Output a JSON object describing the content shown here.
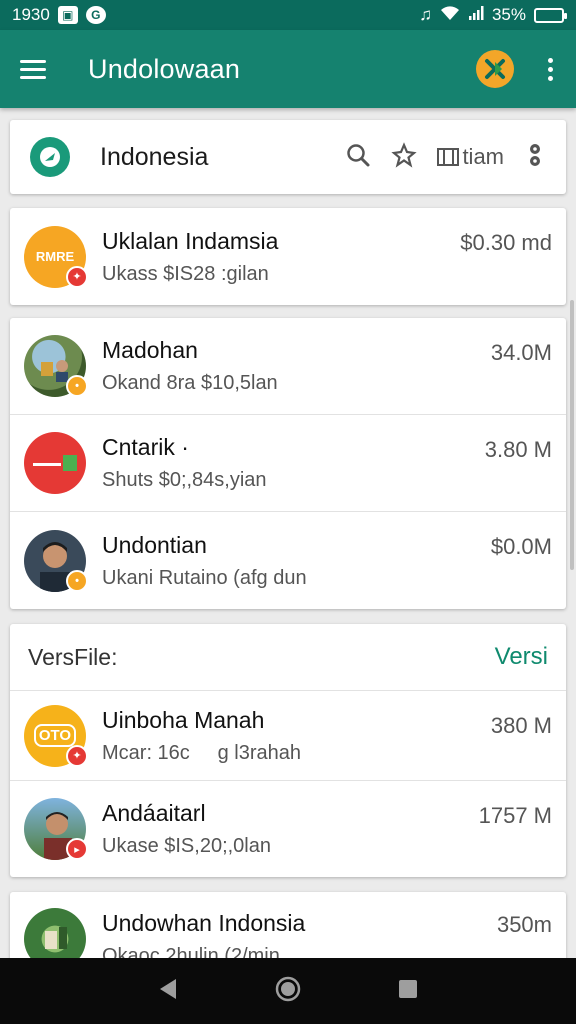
{
  "status_bar": {
    "time": "1930",
    "signal_label": "G",
    "battery_text": "35%",
    "battery_level": 0.35
  },
  "app_bar": {
    "title": "Undolowaan"
  },
  "search_card": {
    "country": "Indonesia",
    "filter_label": "tiam"
  },
  "group1": [
    {
      "title": "Uklalan Indamsia",
      "subtitle": "Ukass $IS28 :gilan",
      "amount": "$0.30 md",
      "avatar_text": "RMRE",
      "avatar_color": "#f6a623",
      "badge_color": "#e53935"
    }
  ],
  "group2": [
    {
      "title": "Madohan",
      "subtitle": "Okand 8ra $10,5lan",
      "amount": "34.0M",
      "avatar_color": "#6d8b4f",
      "badge_color": "#f6a623"
    },
    {
      "title": "Cntarik ·",
      "subtitle": "Shuts $0;,84s,yian",
      "amount": "3.80 M",
      "avatar_text": "▬▬▬",
      "avatar_color": "#e53935",
      "badge_color": "#4caf50"
    },
    {
      "title": "Undontian",
      "subtitle": "Ukani Rutaino (afg dun",
      "amount": "$0.0M",
      "avatar_color": "#8a6a55",
      "badge_color": "#f6a623"
    }
  ],
  "section": {
    "title": "VersFile:",
    "link": "Versi"
  },
  "group3": [
    {
      "title": "Uinboha Manah",
      "subtitle": "Mcar: 16c     g l3rahah",
      "amount": "380 M",
      "avatar_text": "OTO",
      "avatar_color": "#f6b21a",
      "badge_color": "#e53935"
    },
    {
      "title": "Andáaitarl",
      "subtitle": "Ukase $IS,20;,0lan",
      "amount": "1757 M",
      "avatar_color": "#5a86b8",
      "badge_color": "#e53935"
    }
  ],
  "group4": [
    {
      "title": "Undowhan Indonsia",
      "subtitle": "Okaoc 2hulin (2/min",
      "amount": "350m",
      "avatar_color": "#3c7a3a"
    }
  ],
  "colors": {
    "primary": "#15826f",
    "status": "#0b6b5d",
    "accent": "#0f8a6e"
  }
}
